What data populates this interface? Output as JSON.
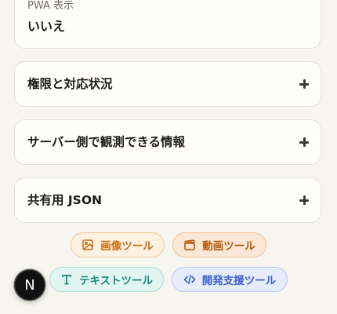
{
  "pwa_card": {
    "label": "PWA 表示",
    "value": "いいえ"
  },
  "accordions": [
    {
      "title": "権限と対応状況"
    },
    {
      "title": "サーバー側で観測できる情報"
    },
    {
      "title": "共有用 JSON"
    }
  ],
  "tool_links": [
    {
      "label": "画像ツール",
      "icon": "image-icon",
      "color": "#c8700f"
    },
    {
      "label": "動画ツール",
      "icon": "clapperboard-icon",
      "color": "#b5580e"
    },
    {
      "label": "テキストツール",
      "icon": "text-type-icon",
      "color": "#168a77"
    },
    {
      "label": "開発支援ツール",
      "icon": "code-icon",
      "color": "#3c5fc8"
    }
  ],
  "avatar": {
    "letter": "N"
  }
}
